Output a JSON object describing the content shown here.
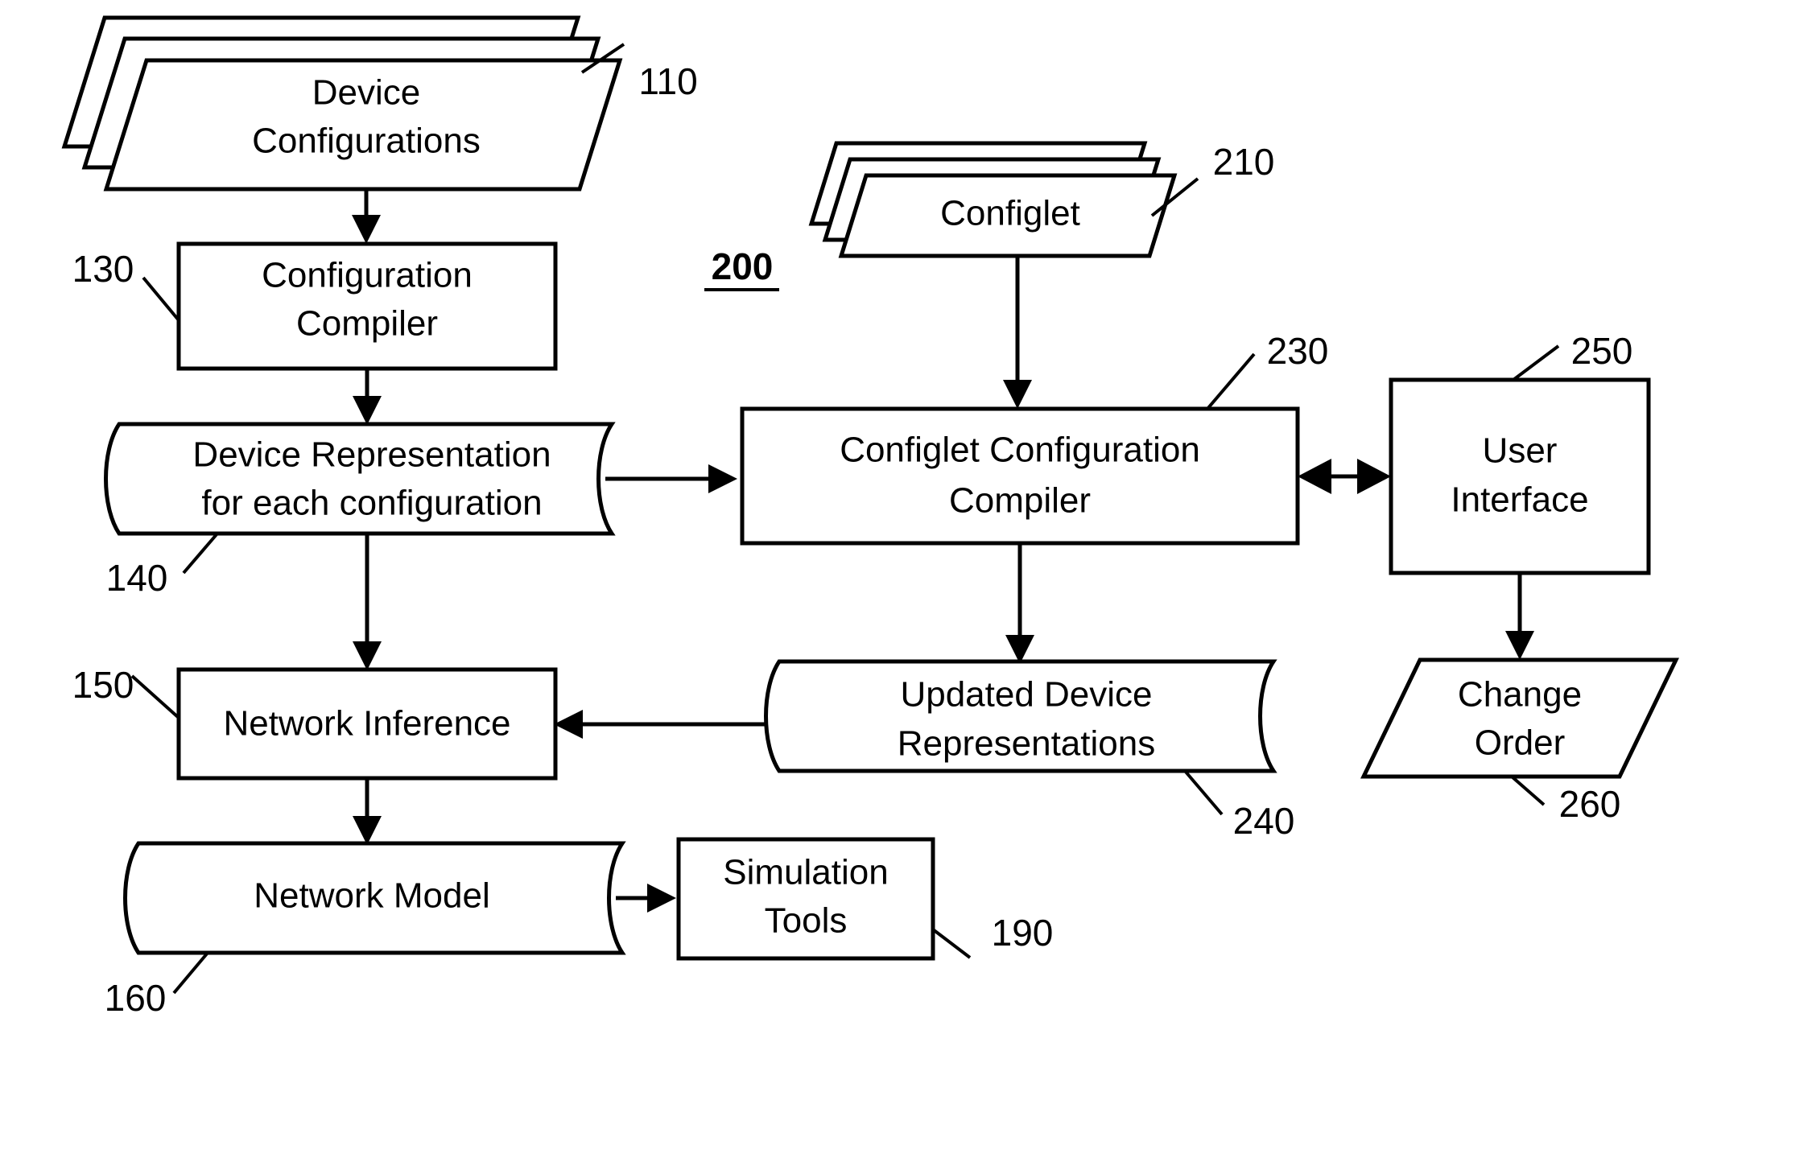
{
  "figure": {
    "label": "200",
    "label_underlined": true
  },
  "nodes": {
    "device_configurations": {
      "label_line1": "Device",
      "label_line2": "Configurations",
      "ref": "110",
      "shape": "stacked-parallelogram"
    },
    "configuration_compiler": {
      "label_line1": "Configuration",
      "label_line2": "Compiler",
      "ref": "130",
      "shape": "rectangle"
    },
    "device_representation": {
      "label_line1": "Device Representation",
      "label_line2": "for each configuration",
      "ref": "140",
      "shape": "tape"
    },
    "network_inference": {
      "label_line1": "Network Inference",
      "ref": "150",
      "shape": "rectangle"
    },
    "network_model": {
      "label_line1": "Network Model",
      "ref": "160",
      "shape": "tape"
    },
    "simulation_tools": {
      "label_line1": "Simulation",
      "label_line2": "Tools",
      "ref": "190",
      "shape": "rectangle"
    },
    "configlet": {
      "label_line1": "Configlet",
      "ref": "210",
      "shape": "stacked-parallelogram"
    },
    "configlet_configuration_compiler": {
      "label_line1": "Configlet Configuration",
      "label_line2": "Compiler",
      "ref": "230",
      "shape": "rectangle"
    },
    "updated_device_representations": {
      "label_line1": "Updated Device",
      "label_line2": "Representations",
      "ref": "240",
      "shape": "tape"
    },
    "user_interface": {
      "label_line1": "User",
      "label_line2": "Interface",
      "ref": "250",
      "shape": "rectangle"
    },
    "change_order": {
      "label_line1": "Change",
      "label_line2": "Order",
      "ref": "260",
      "shape": "parallelogram"
    }
  },
  "colors": {
    "stroke": "#000000",
    "fill": "#ffffff"
  }
}
